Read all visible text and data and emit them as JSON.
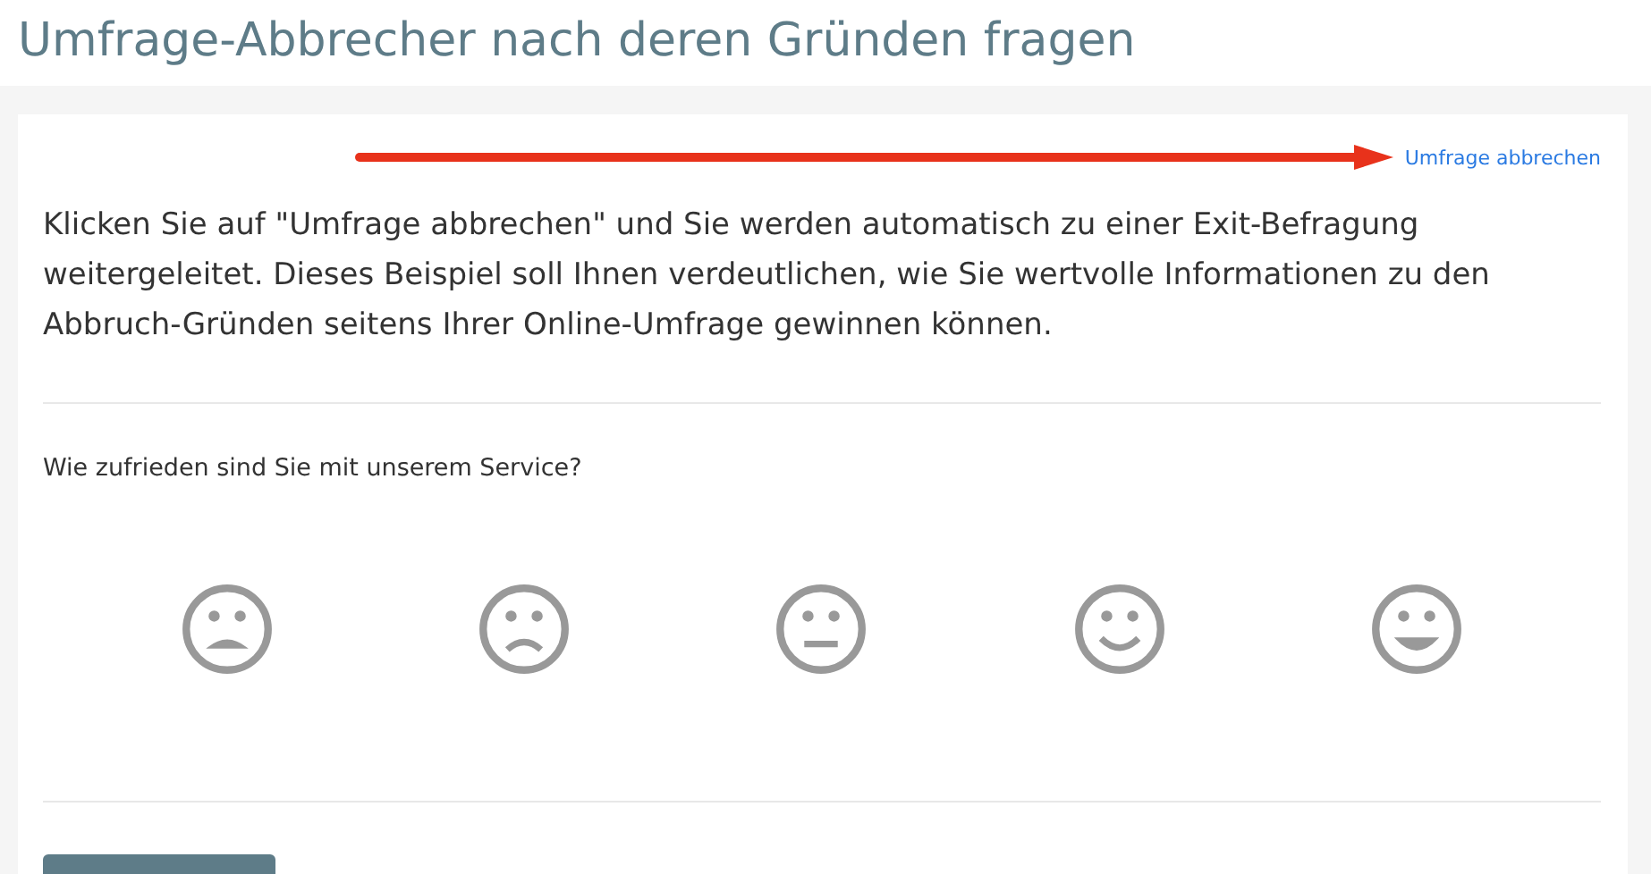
{
  "page_title": "Umfrage-Abbrecher nach deren Gründen fragen",
  "cancel_link": "Umfrage abbrechen",
  "intro": "Klicken Sie auf \"Umfrage abbrechen\" und Sie werden automatisch zu einer Exit-Befragung weitergeleitet. Dieses Beispiel soll Ihnen verdeutlichen, wie Sie wertvolle Informationen zu den Abbruch-Gründen seitens Ihrer Online-Umfrage gewinnen können.",
  "question": "Wie zufrieden sind Sie mit unserem Service?",
  "faces": [
    {
      "kind": "very-sad"
    },
    {
      "kind": "sad"
    },
    {
      "kind": "neutral"
    },
    {
      "kind": "happy"
    },
    {
      "kind": "very-happy"
    }
  ]
}
